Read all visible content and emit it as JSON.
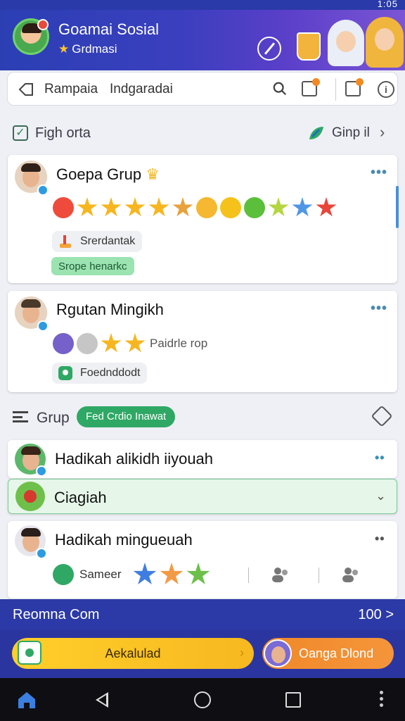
{
  "status_bar": {
    "time": "1:05"
  },
  "header": {
    "title": "Goamai Sosial",
    "subtitle": "Grdmasi"
  },
  "search_bar": {
    "label_left": "Rampaia",
    "label_right": "Indgaradai"
  },
  "section_top": {
    "label": "Figh orta",
    "right_label": "Ginp il"
  },
  "cards": [
    {
      "title": "Goepa Grup",
      "chip": "Srerdantak",
      "green_chip": "Srope henarkc"
    },
    {
      "title": "Rgutan Mingikh",
      "inline_text": "Paidrle rop",
      "chip": "Foednddodt"
    }
  ],
  "section_group": {
    "label": "Grup",
    "pill": "Fed Crdio Inawat"
  },
  "list": [
    {
      "title": "Hadikah alikidh iiyouah"
    },
    {
      "title": "Ciagiah"
    },
    {
      "title": "Hadikah minguеuah",
      "chip_label": "Sameer"
    }
  ],
  "banner": {
    "title": "Reomna Com",
    "count": "100 >"
  },
  "actions": {
    "primary_label": "Aekalulad",
    "secondary_label": "Oanga Dlond"
  },
  "colors": {
    "header_start": "#2b3fb3",
    "header_end": "#7b55d4",
    "accent_green": "#2fa865",
    "banner_blue": "#2b3aa6",
    "primary_yellow": "#ffcf2a",
    "secondary_orange": "#f0892a"
  }
}
